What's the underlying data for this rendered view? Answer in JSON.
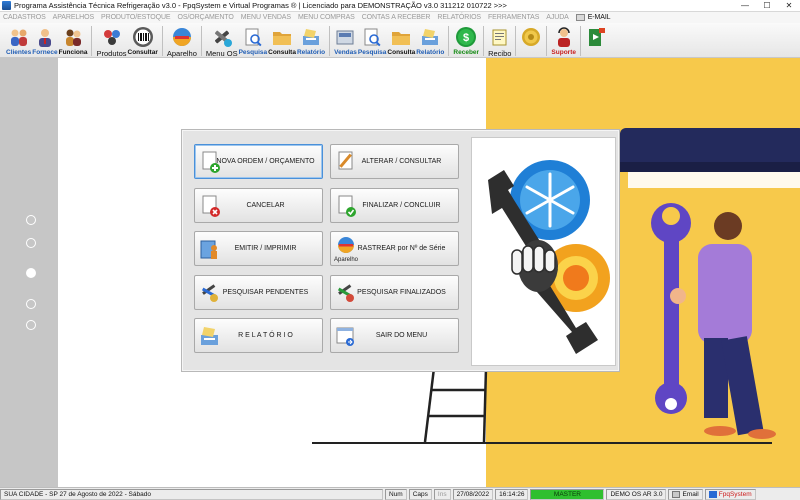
{
  "window": {
    "title": "Programa Assistência Técnica Refrigeração v3.0 - FpqSystem e Virtual Programas ® | Licenciado para  DEMONSTRAÇÃO v3.0 311212 010722 >>>",
    "minimize": "—",
    "maximize": "☐",
    "close": "✕"
  },
  "menu": {
    "items": [
      "CADASTROS",
      "APARELHOS",
      "PRODUTO/ESTOQUE",
      "OS/ORÇAMENTO",
      "MENU VENDAS",
      "MENU COMPRAS",
      "CONTAS A RECEBER",
      "RELATÓRIOS",
      "FERRAMENTAS",
      "AJUDA"
    ],
    "email": "E-MAIL"
  },
  "toolbar": {
    "clientes": "Clientes",
    "fornece": "Fornece",
    "funciona": "Funciona",
    "produtos": "Produtos",
    "consultar": "Consultar",
    "aparelho": "Aparelho",
    "menu_os": "Menu OS",
    "pesquisa_os": "Pesquisa",
    "consulta_os": "Consulta",
    "relatorio_os": "Relatório",
    "vendas": "Vendas",
    "pesquisa_v": "Pesquisa",
    "consulta_v": "Consulta",
    "relatorio_v": "Relatório",
    "receber": "Receber",
    "recibo": "Recibo",
    "suporte": "Suporte",
    "colors": {
      "green": "#148a14",
      "blue": "#1f5db5",
      "red": "#c81e1e"
    }
  },
  "dialog": {
    "buttons": {
      "nova_ordem": "NOVA ORDEM / ORÇAMENTO",
      "alterar": "ALTERAR  /  CONSULTAR",
      "cancelar": "CANCELAR",
      "finalizar": "FINALIZAR  /  CONCLUIR",
      "emitir": "EMITIR  /  IMPRIMIR",
      "rastrear": "RASTREAR por Nº de Série",
      "rastrear_sub": "Aparelho",
      "pend": "PESQUISAR PENDENTES",
      "final": "PESQUISAR FINALIZADOS",
      "relatorio": "R E L A T Ó R I O",
      "sair": "SAIR DO MENU"
    }
  },
  "status": {
    "city_date": "SUA CIDADE - SP 27 de Agosto de 2022 - Sábado",
    "num": "Num",
    "caps": "Caps",
    "ins": "Ins",
    "date": "27/08/2022",
    "time": "16:14:26",
    "master": "MASTER",
    "demo": "DEMO OS AR 3.0",
    "email": "Email",
    "brand": "FpqSystem",
    "master_color": "#2fbf2f"
  }
}
